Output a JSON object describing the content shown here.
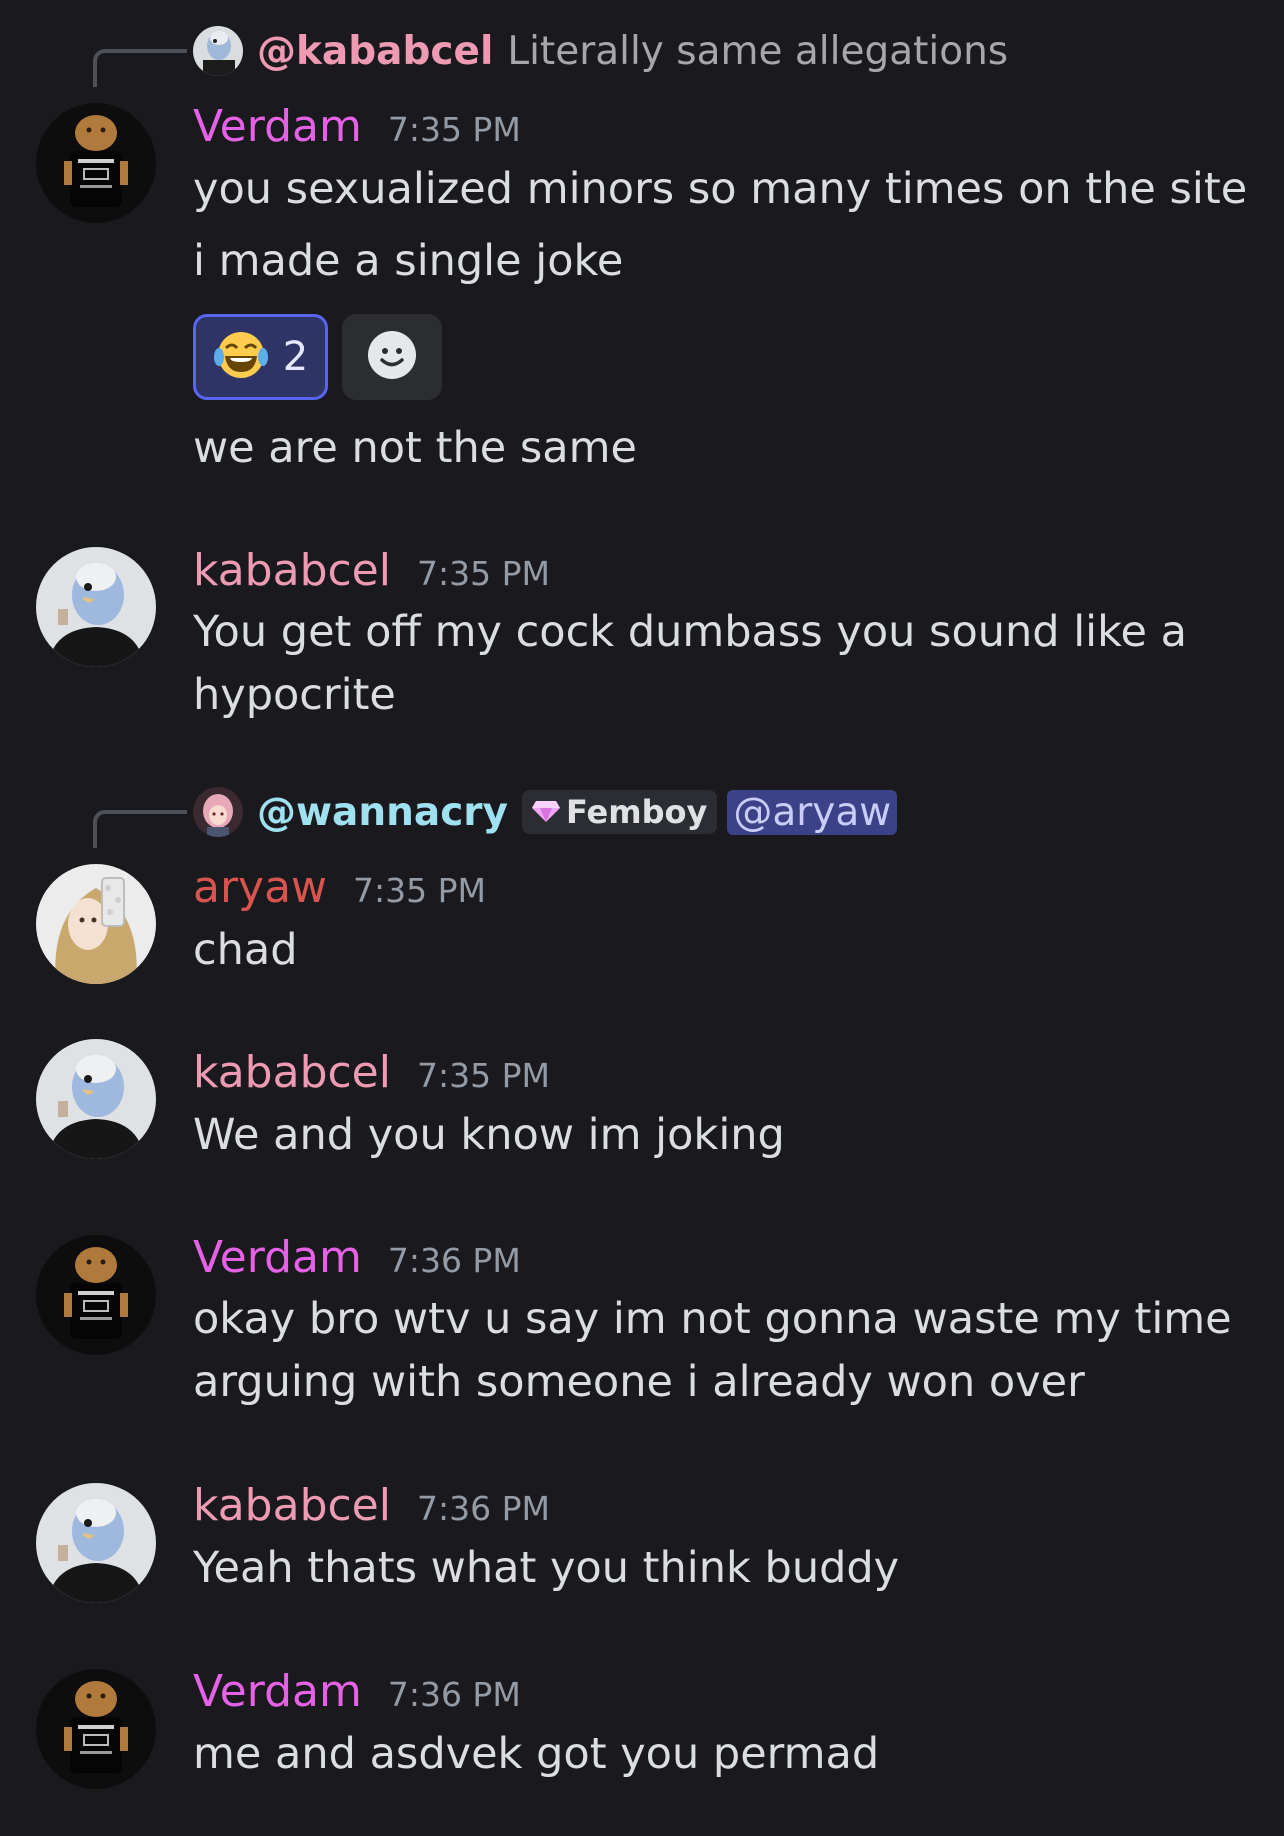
{
  "colors": {
    "background": "#1a1a1e",
    "verdam": "#e561e6",
    "kababcel": "#ee9ab2",
    "aryaw": "#d9544f",
    "wannacry": "#9fe1f0",
    "mention_bg": "#3c4287",
    "reaction_border": "#5865f2"
  },
  "reply1": {
    "mention": "@kababcel",
    "text": "Literally same allegations",
    "avatar_icon": "budgie-avatar-icon"
  },
  "msg1": {
    "username": "Verdam",
    "time": "7:35 PM",
    "lines": [
      "you sexualized minors so many times on the site",
      "i made a single joke"
    ],
    "reaction": {
      "emoji": "😂",
      "count": "2",
      "icon": "laughing-crying-emoji-icon"
    },
    "add_reaction_icon": "add-reaction-smiley-icon",
    "followup": "we are not the same"
  },
  "msg2": {
    "username": "kababcel",
    "time": "7:35 PM",
    "lines": [
      "You get off my cock dumbass you sound like a",
      "hypocrite"
    ]
  },
  "reply2": {
    "mention": "@wannacry",
    "role_tag": "Femboy",
    "role_icon": "diamond-icon",
    "highlight": "@aryaw"
  },
  "msg3": {
    "username": "aryaw",
    "time": "7:35 PM",
    "lines": [
      "chad"
    ]
  },
  "msg4": {
    "username": "kababcel",
    "time": "7:35 PM",
    "lines": [
      "We and you know im joking"
    ]
  },
  "msg5": {
    "username": "Verdam",
    "time": "7:36 PM",
    "lines": [
      "okay bro wtv u say im not gonna waste my time",
      "arguing with someone i already won over"
    ]
  },
  "msg6": {
    "username": "kababcel",
    "time": "7:36 PM",
    "lines": [
      "Yeah thats what you think buddy"
    ]
  },
  "msg7": {
    "username": "Verdam",
    "time": "7:36 PM",
    "lines": [
      "me and asdvek got you permad"
    ]
  }
}
